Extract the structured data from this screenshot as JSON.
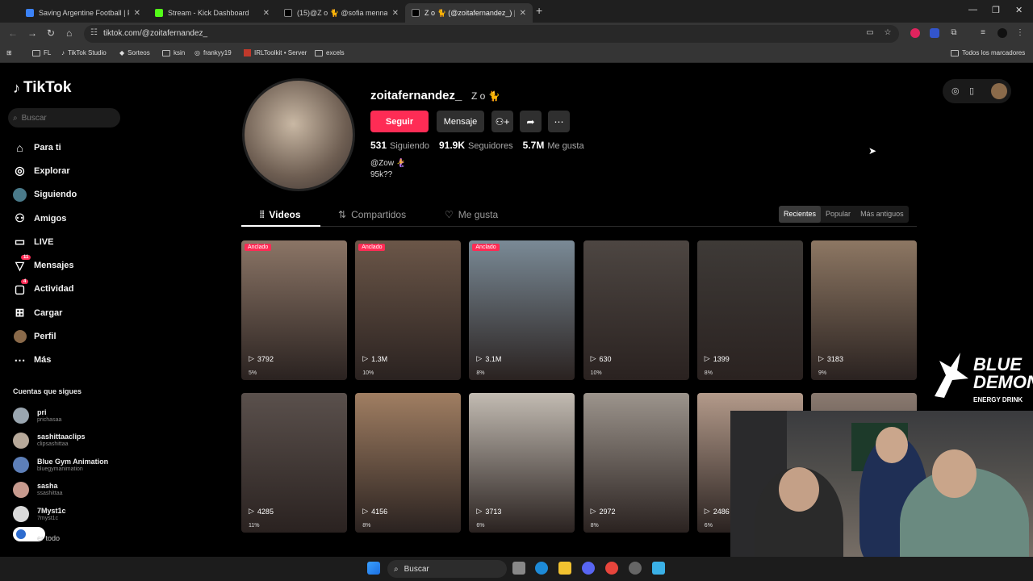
{
  "browser": {
    "tabs": [
      {
        "title": "Saving Argentine Football | Pla",
        "color": "#3b82f6",
        "active": false
      },
      {
        "title": "Stream - Kick Dashboard",
        "color": "#53fc18",
        "active": false
      },
      {
        "title": "(15)@Z o 🐈 @sofia menna | Ti",
        "color": "#ffffff",
        "active": false
      },
      {
        "title": "Z o 🐈 (@zoitafernandez_) |",
        "color": "#ffffff",
        "active": true
      }
    ],
    "url": "tiktok.com/@zoitafernandez_",
    "bookmarks": [
      "FL",
      "TikTok Studio",
      "Sorteos",
      "ksin",
      "frankyy19",
      "IRLToolkit • Server",
      "excels"
    ],
    "all_bookmarks": "Todos los marcadores"
  },
  "tiktok": {
    "logo": "TikTok",
    "search_placeholder": "Buscar",
    "nav": [
      {
        "label": "Para ti",
        "icon": "home-icon"
      },
      {
        "label": "Explorar",
        "icon": "compass-icon"
      },
      {
        "label": "Siguiendo",
        "icon": "following-icon"
      },
      {
        "label": "Amigos",
        "icon": "friends-icon"
      },
      {
        "label": "LIVE",
        "icon": "live-icon"
      },
      {
        "label": "Mensajes",
        "icon": "messages-icon",
        "badge": "11"
      },
      {
        "label": "Actividad",
        "icon": "activity-icon",
        "badge": "4"
      },
      {
        "label": "Cargar",
        "icon": "upload-icon"
      },
      {
        "label": "Perfil",
        "icon": "profile-icon"
      },
      {
        "label": "Más",
        "icon": "more-icon"
      }
    ],
    "following_title": "Cuentas que sigues",
    "following": [
      {
        "name": "pri",
        "handle": "prichasaa",
        "color": "#9aa6b0"
      },
      {
        "name": "sashittaaclips",
        "handle": "clipsashittaa",
        "color": "#b7a99a"
      },
      {
        "name": "Blue Gym Animation",
        "handle": "bluegymanimation",
        "color": "#5d7fb8"
      },
      {
        "name": "sasha",
        "handle": "ssashittaa",
        "color": "#c79a8e"
      },
      {
        "name": "7Myst1c",
        "handle": "7myst1c",
        "color": "#d9d9d9"
      }
    ],
    "see_all": "er todo"
  },
  "profile": {
    "username": "zoitafernandez_",
    "nickname": "Z o 🐈",
    "follow_btn": "Seguir",
    "message_btn": "Mensaje",
    "following_count": "531",
    "following_label": "Siguiendo",
    "followers_count": "91.9K",
    "followers_label": "Seguidores",
    "likes_count": "5.7M",
    "likes_label": "Me gusta",
    "bio_line1": "@Zow 🧜‍♀️",
    "bio_line2": "95k??",
    "tabs": [
      "Videos",
      "Compartidos",
      "Me gusta"
    ],
    "sort": [
      "Recientes",
      "Popular",
      "Más antiguos"
    ]
  },
  "videos": [
    {
      "views": "3792",
      "pct": "5%",
      "pinned": "Anclado",
      "bg": "#8b7566"
    },
    {
      "views": "1.3M",
      "pct": "10%",
      "pinned": "Anclado",
      "bg": "#6b5648"
    },
    {
      "views": "3.1M",
      "pct": "8%",
      "pinned": "Anclado",
      "bg": "#7a8a96"
    },
    {
      "views": "630",
      "pct": "10%",
      "pinned": "",
      "bg": "#4d4642"
    },
    {
      "views": "1399",
      "pct": "8%",
      "pinned": "",
      "bg": "#3e3a37"
    },
    {
      "views": "3183",
      "pct": "9%",
      "pinned": "",
      "bg": "#8d7763"
    },
    {
      "views": "4285",
      "pct": "11%",
      "pinned": "",
      "bg": "#5a504c"
    },
    {
      "views": "4156",
      "pct": "8%",
      "pinned": "",
      "bg": "#a07e62"
    },
    {
      "views": "3713",
      "pct": "6%",
      "pinned": "",
      "bg": "#c2bbb2"
    },
    {
      "views": "2972",
      "pct": "8%",
      "pinned": "",
      "bg": "#9c948c"
    },
    {
      "views": "2486",
      "pct": "6%",
      "pinned": "",
      "bg": "#b39a8a"
    },
    {
      "views": "",
      "pct": "",
      "pinned": "",
      "bg": "#8a7a70"
    }
  ],
  "overlay": {
    "brand1": "BLUE",
    "brand2": "DEMON",
    "brand3": "ENERGY DRINK"
  },
  "taskbar": {
    "search": "Buscar"
  }
}
